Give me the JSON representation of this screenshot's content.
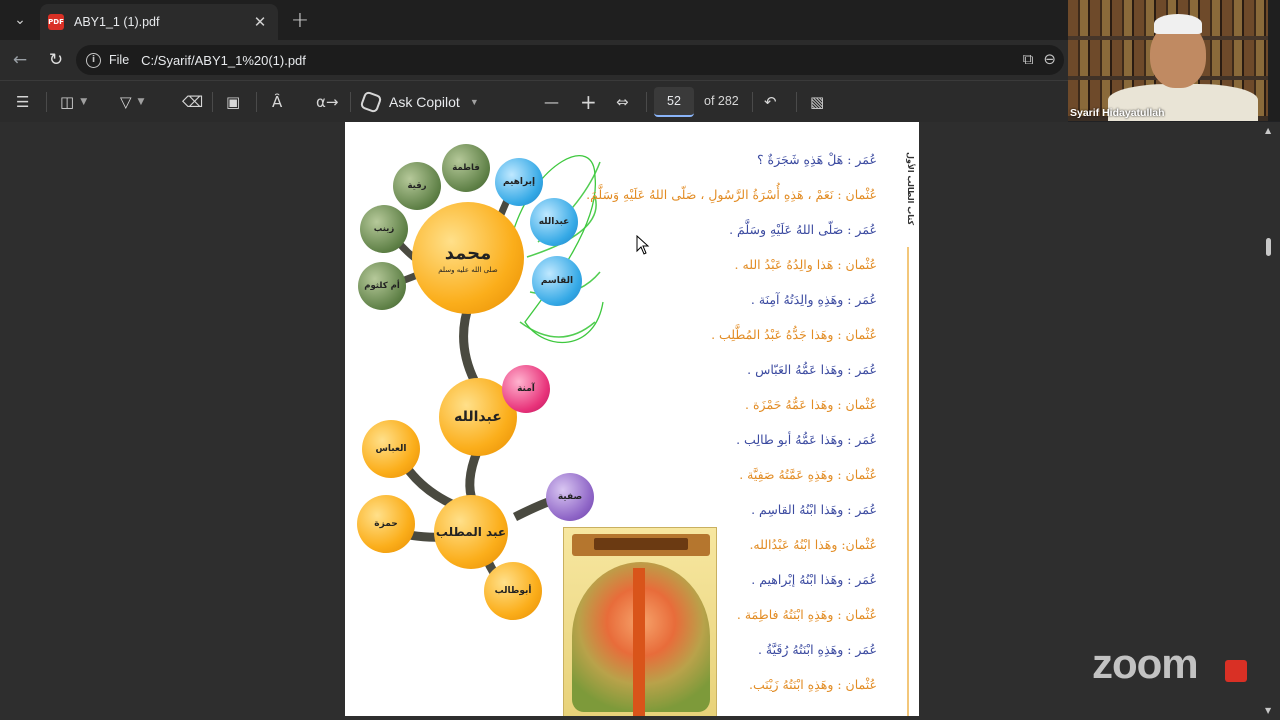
{
  "browser": {
    "tab": {
      "title": "ABY1_1 (1).pdf",
      "icon": "pdf-icon",
      "icon_label": "PDF"
    },
    "address": {
      "scheme": "File",
      "url": "C:/Syarif/ABY1_1%20(1).pdf"
    }
  },
  "pdf_toolbar": {
    "copilot_label": "Ask Copilot",
    "page_current": "52",
    "page_total": "of 282"
  },
  "diagram": {
    "center": {
      "name": "محمد",
      "honorific": "صلى الله عليه وسلم"
    },
    "children": [
      "فاطمة",
      "رقية",
      "زينب",
      "أم كلثوم",
      "إبراهيم",
      "عبدالله",
      "القاسم"
    ],
    "father": "عبدالله",
    "mother": "آمنة",
    "grandfather": "عبد المطلب",
    "uncles_aunt": [
      "العباس",
      "حمزة",
      "أبوطالب",
      "صفية"
    ]
  },
  "page_side_title": "كتاب الطالب الأول",
  "dialogue": [
    {
      "speaker": "umar",
      "text": "عُمَر : هَلْ هَذِهِ شَجَرَةٌ ؟"
    },
    {
      "speaker": "uthman",
      "text": "عُثْمان : نَعَمْ ، هَذِهِ أُسْرَةُ الرَّسُولِ ، صَلّى اللهُ عَلَيْهِ وَسَلَّمَ."
    },
    {
      "speaker": "umar",
      "text": "عُمَر : صَلّى اللهُ عَلَيْهِ وسَلَّمَ ."
    },
    {
      "speaker": "uthman",
      "text": "عُثْمان : هَذا والِدُهُ عَبْدُ الله ."
    },
    {
      "speaker": "umar",
      "text": "عُمَر : وهَذِهِ والِدَتُهُ آمِنَة ."
    },
    {
      "speaker": "uthman",
      "text": "عُثْمان : وهَذا جَدُّهُ عَبْدُ المُطَّلِب ."
    },
    {
      "speaker": "umar",
      "text": "عُمَر : وهَذا عَمُّهُ العَبّاس ."
    },
    {
      "speaker": "uthman",
      "text": "عُثْمان : وهَذا عَمُّهُ حَمْزَة ."
    },
    {
      "speaker": "umar",
      "text": "عُمَر : وهَذا عَمُّهُ أبو طالِب ."
    },
    {
      "speaker": "uthman",
      "text": "عُثْمان : وهَذِهِ عَمَّتُهُ صَفِيَّة ."
    },
    {
      "speaker": "umar",
      "text": "عُمَر : وهَذا ابْنُهُ القاسِم ."
    },
    {
      "speaker": "uthman",
      "text": "عُثْمان: وهَذا ابْنُهُ عَبْدُالله."
    },
    {
      "speaker": "umar",
      "text": "عُمَر : وهَذا ابْنُهُ إبْراهيم ."
    },
    {
      "speaker": "uthman",
      "text": "عُثْمان : وهَذِهِ ابْنَتُهُ فاطِمَة ."
    },
    {
      "speaker": "umar",
      "text": "عُمَر : وهَذِهِ ابْنَتُهُ رُقَيَّةُ ."
    },
    {
      "speaker": "uthman",
      "text": "عُثْمان : وهَذِهِ ابْنَتُهُ زَيْنَب."
    }
  ],
  "webcam": {
    "participant_name": "Syarif Hidayatullah"
  },
  "watermark": "zoom",
  "colors": {
    "umar": "#3b4aa0",
    "uthman": "#e28c24",
    "accent": "#8ab4f8"
  }
}
